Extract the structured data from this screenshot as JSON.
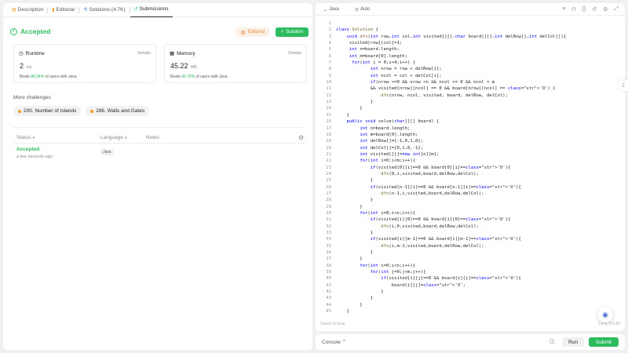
{
  "left_tabs": [
    {
      "label": "Description",
      "icon": "description-icon"
    },
    {
      "label": "Editorial",
      "icon": "editorial-icon"
    },
    {
      "label": "Solutions (4.7K)",
      "icon": "solutions-icon"
    },
    {
      "label": "Submissions",
      "icon": "submissions-icon"
    }
  ],
  "result": {
    "status": "Accepted",
    "editorial_label": "Editorial",
    "solution_label": "Solution"
  },
  "runtime": {
    "title": "Runtime",
    "details": "Details",
    "value": "2",
    "unit": "ms",
    "beats_prefix": "Beats",
    "beats_pct": "88.34%",
    "beats_suffix": "of users with Java"
  },
  "memory": {
    "title": "Memory",
    "details": "Details",
    "value": "45.22",
    "unit": "MB",
    "beats_prefix": "Beats",
    "beats_pct": "66.78%",
    "beats_suffix": "of users with Java"
  },
  "more_challenges": {
    "label": "More challenges",
    "items": [
      "200. Number of Islands",
      "286. Walls and Gates"
    ]
  },
  "submissions_table": {
    "headers": {
      "status": "Status",
      "language": "Language",
      "notes": "Notes"
    },
    "rows": [
      {
        "status": "Accepted",
        "time": "a few seconds ago",
        "language": "Java",
        "notes": ""
      }
    ]
  },
  "editor": {
    "language": "Java",
    "mode": "Auto",
    "saved": "Saved to local",
    "cursor": "Ln 4, Col 80",
    "line_numbers": [
      "1",
      "2",
      "3",
      "4",
      "5",
      "6",
      "7",
      "8",
      "9",
      "10",
      "11",
      "12",
      "13",
      "14",
      "15",
      "16",
      "17",
      "18",
      "19",
      "20",
      "21",
      "22",
      "23",
      "24",
      "25",
      "26",
      "27",
      "28",
      "29",
      "30",
      "31",
      "32",
      "33",
      "34",
      "35",
      "36",
      "37",
      "38",
      "39",
      "40",
      "41",
      "42",
      "43",
      "44",
      "45"
    ],
    "code_lines": [
      "",
      "class Solution {",
      "    void dfs(int row,int col,int visited[][],char board[][],int delRow[],int delCol[]){",
      "     visited[row][col]=1;",
      "     int n=board.length;",
      "     int m=board[0].length;",
      "      for(int i = 0;i<4;i++) {",
      "             int nrow = row + delRow[i];",
      "             int ncol = col + delCol[i];",
      "             if(nrow >=0 && nrow <n && ncol >= 0 && ncol < m",
      "             && visited[nrow][ncol] == 0 && board[nrow][ncol] == 'O') {",
      "                 dfs(nrow, ncol, visited, board, delRow, delCol);",
      "             }",
      "         }",
      "    }",
      "    public void solve(char[][] board) {",
      "         int n=board.length;",
      "         int m=board[0].length;",
      "         int delRow[]={-1,0,1,0};",
      "         int delCol[]={0,1,0,-1};",
      "         int visited[][]=new int[n][m];",
      "         for(int i=0;i<m;i++){",
      "             if(visited[0][i]==0 && board[0][i]=='O'){",
      "                 dfs(0,i,visited,board,delRow,delCol);",
      "             }",
      "             if(visited[n-1][i]==0 && board[n-1][i]=='O'){",
      "                 dfs(n-1,i,visited,board,delRow,delCol);",
      "             }",
      "         }",
      "         for(int i=0;i<n;i++){",
      "             if(visited[i][0]==0 && board[i][0]=='O'){",
      "                 dfs(i,0,visited,board,delRow,delCol);",
      "             }",
      "             if(visited[i][m-1]==0 && board[i][m-1]=='O'){",
      "                 dfs(i,m-1,visited,board,delRow,delCol);",
      "             }",
      "         }",
      "         for(int i=0;i<n;i++){",
      "             for(int j=0;j<m;j++){",
      "                 if(visited[i][j]==0 && board[i][j]=='O'){",
      "                     board[i][j]='X';",
      "                 }",
      "             }",
      "         }",
      "    }"
    ]
  },
  "console": {
    "label": "Console",
    "run_label": "Run",
    "submit_label": "Submit"
  },
  "colors": {
    "accent_green": "#2cbb5d",
    "editorial_orange": "#e08a3a",
    "keyword_blue": "#0000ff"
  }
}
